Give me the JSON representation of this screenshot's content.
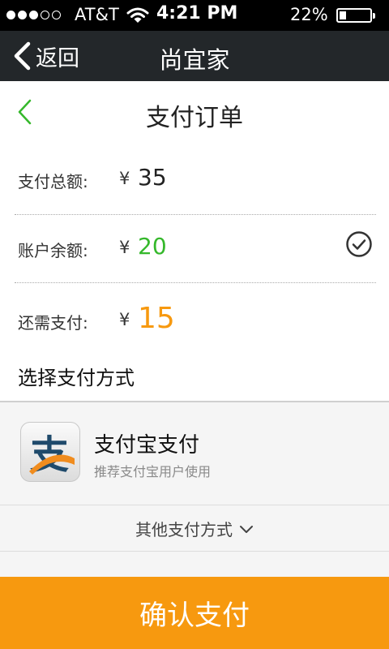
{
  "status_bar": {
    "carrier": "AT&T",
    "time": "4:21 PM",
    "battery": "22%"
  },
  "nav": {
    "back_label": "返回",
    "title": "尚宜家"
  },
  "order": {
    "title": "支付订单",
    "total": {
      "label": "支付总额:",
      "currency": "¥",
      "amount": "35"
    },
    "balance": {
      "label": "账户余额:",
      "currency": "¥",
      "amount": "20"
    },
    "remaining": {
      "label": "还需支付:",
      "currency": "¥",
      "amount": "15"
    },
    "select_method": "选择支付方式"
  },
  "alipay": {
    "name": "支付宝支付",
    "desc": "推荐支付宝用户使用"
  },
  "other_methods": "其他支付方式",
  "confirm": "确认支付",
  "colors": {
    "green": "#35b82b",
    "orange": "#f7990f",
    "nav_bg": "#23272a"
  }
}
